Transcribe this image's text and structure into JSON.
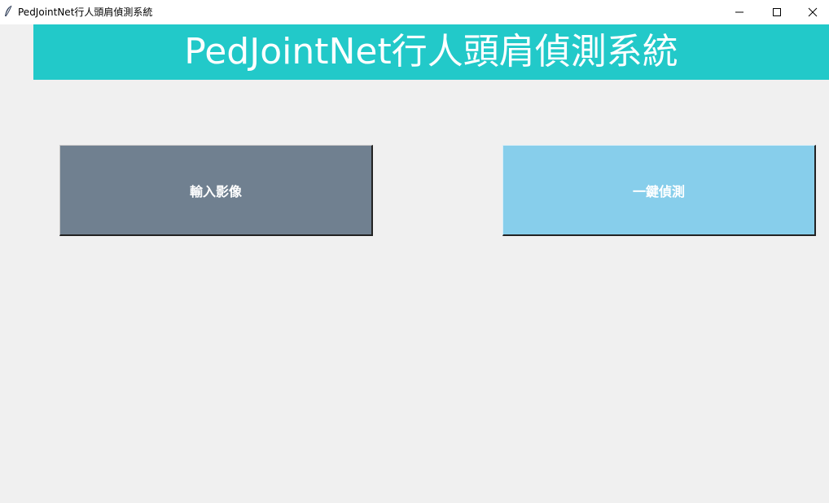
{
  "window": {
    "title": "PedJointNet行人頭肩偵測系統",
    "icon": "feather-icon",
    "controls": [
      "minimize-icon",
      "maximize-icon",
      "close-icon"
    ]
  },
  "header": {
    "title": "PedJointNet行人頭肩偵測系統",
    "background_color": "#22c9c9",
    "text_color": "#ffffff"
  },
  "buttons": {
    "input_image": {
      "label": "輸入影像",
      "color": "#708090"
    },
    "one_click_detect": {
      "label": "一鍵偵測",
      "color": "#87ceeb"
    }
  },
  "background_color": "#f0f0f0"
}
